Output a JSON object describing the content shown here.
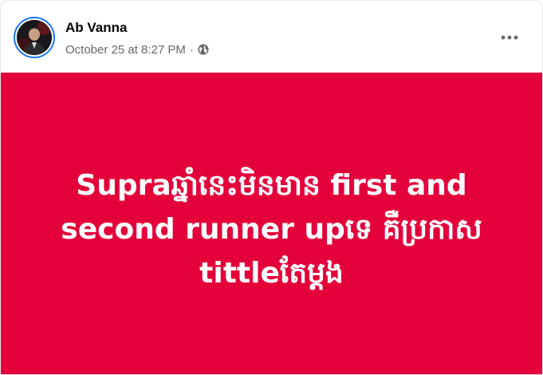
{
  "post": {
    "author": {
      "name": "Ab Vanna",
      "avatar_icon": "profile-photo"
    },
    "timestamp": "October 25 at 8:27 PM",
    "separator": "·",
    "privacy_icon": "globe-icon",
    "more_icon": "ellipsis-icon",
    "text_lines": [
      "Supraឆ្នាំនេះមិនមាន first and",
      "second runner upទេ គឺប្រកាស",
      "tittleតែម្តង"
    ],
    "background_color": "#e4003a",
    "text_color": "#ffffff",
    "accent_color": "#1877f2"
  }
}
